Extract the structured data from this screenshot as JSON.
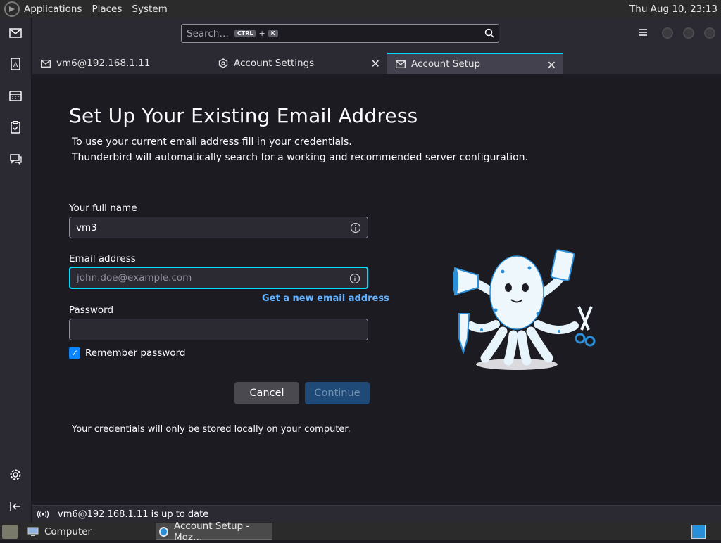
{
  "topbar": {
    "menus": [
      "Applications",
      "Places",
      "System"
    ],
    "clock": "Thu Aug 10, 23:13"
  },
  "toolbar": {
    "search_placeholder": "Search…",
    "shortcut_key1": "CTRL",
    "shortcut_plus": "+",
    "shortcut_key2": "K"
  },
  "tabs": [
    {
      "label": "vm6@192.168.1.11",
      "icon": "mail-icon"
    },
    {
      "label": "Account Settings",
      "icon": "settings-hex-icon"
    },
    {
      "label": "Account Setup",
      "icon": "mail-icon"
    }
  ],
  "setup": {
    "title": "Set Up Your Existing Email Address",
    "intro_line1": "To use your current email address fill in your credentials.",
    "intro_line2": "Thunderbird will automatically search for a working and recommended server configuration.",
    "name_label": "Your full name",
    "name_value": "vm3",
    "email_label": "Email address",
    "email_placeholder": "john.doe@example.com",
    "new_email_link": "Get a new email address",
    "password_label": "Password",
    "remember_label": "Remember password",
    "remember_checked": true,
    "cancel_label": "Cancel",
    "continue_label": "Continue",
    "note": "Your credentials will only be stored locally on your computer."
  },
  "status": {
    "text": "vm6@192.168.1.11 is up to date"
  },
  "taskbar": {
    "items": [
      "Computer",
      "Account Setup - Moz…"
    ]
  },
  "colors": {
    "accent": "#00ddff",
    "background": "#1c1b22",
    "panel": "#2b2a33",
    "link": "#63b2ff",
    "checkbox": "#0a84ff"
  }
}
